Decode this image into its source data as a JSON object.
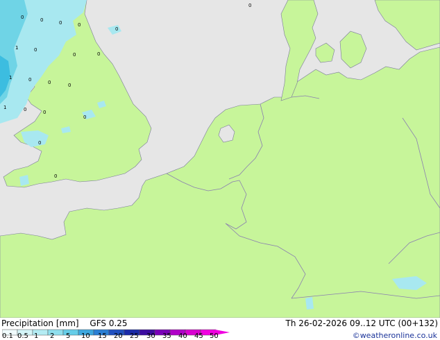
{
  "map": {
    "land_color": "#c7f59a",
    "sea_color": "#e6e6e6",
    "border_color": "#8a7fb0",
    "precip_light": "#a8e8f0",
    "precip_medium": "#6fd4e6",
    "precip_heavy": "#3cbde0",
    "point_labels": [
      "0",
      "0",
      "0",
      "0",
      "0",
      "0",
      "1",
      "0",
      "0",
      "1",
      "0",
      "0",
      "0",
      "1",
      "0",
      "0",
      "0",
      "0",
      "0",
      "0"
    ]
  },
  "footer": {
    "title": "Precipitation [mm]",
    "model": "GFS 0.25",
    "datetime": "Th 26-02-2026 09..12 UTC (00+132)",
    "credit": "©weatheronline.co.uk",
    "scale_ticks": [
      "0.1",
      "0.5",
      "1",
      "2",
      "5",
      "10",
      "15",
      "20",
      "25",
      "30",
      "35",
      "40",
      "45",
      "50"
    ],
    "scale_colors": [
      "#f0fbfc",
      "#d4f5f8",
      "#b4ecf3",
      "#8fdfee",
      "#66cde8",
      "#3da8e0",
      "#2a7fd4",
      "#2050c0",
      "#1a2aa8",
      "#3c0ca0",
      "#7a00b8",
      "#b000c8",
      "#d800d0",
      "#f000e0"
    ]
  }
}
